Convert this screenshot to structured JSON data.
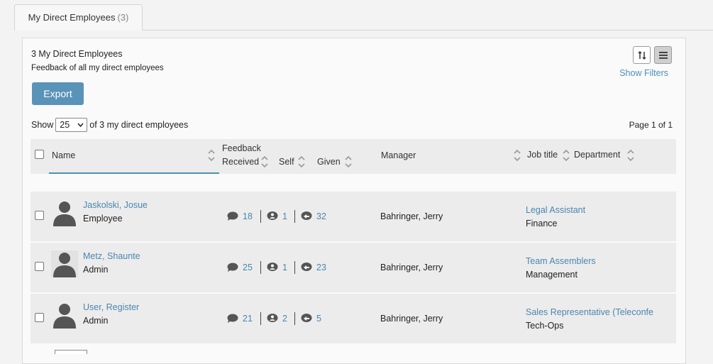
{
  "tab": {
    "label": "My Direct Employees",
    "count": "(3)"
  },
  "header": {
    "title": "3 My Direct Employees",
    "subtitle": "Feedback of all my direct employees",
    "show_filters": "Show Filters",
    "export_label": "Export"
  },
  "pagination": {
    "show_label": "Show",
    "page_size": "25",
    "of_text": "of 3 my direct employees",
    "page_info": "Page 1 of 1"
  },
  "columns": {
    "name": "Name",
    "feedback_received_1": "Feedback",
    "feedback_received_2": "Received",
    "self": "Self",
    "given": "Given",
    "manager": "Manager",
    "job_title": "Job title",
    "department": "Department"
  },
  "rows": [
    {
      "name": "Jaskolski, Josue",
      "role": "Employee",
      "received": "18",
      "self": "1",
      "given": "32",
      "manager": "Bahringer, Jerry",
      "job_title": "Legal Assistant",
      "department": "Finance"
    },
    {
      "name": "Metz, Shaunte",
      "role": "Admin",
      "received": "25",
      "self": "1",
      "given": "23",
      "manager": "Bahringer, Jerry",
      "job_title": "Team Assemblers",
      "department": "Management"
    },
    {
      "name": "User, Register",
      "role": "Admin",
      "received": "21",
      "self": "2",
      "given": "5",
      "manager": "Bahringer, Jerry",
      "job_title": "Sales Representative (Teleconfe",
      "department": "Tech-Ops"
    }
  ],
  "colors": {
    "accent": "#4a86b0",
    "button": "#5a93b8"
  }
}
